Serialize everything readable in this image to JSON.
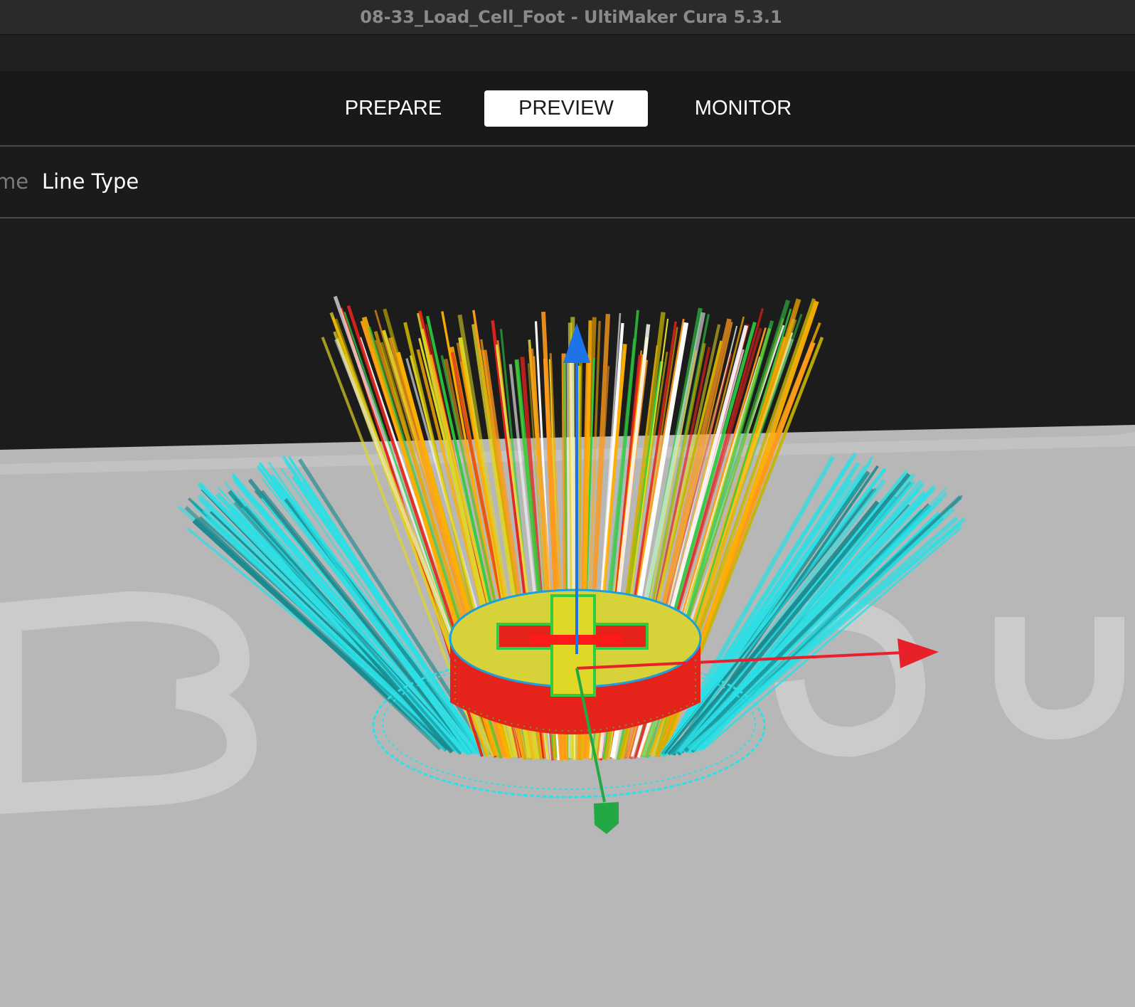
{
  "window": {
    "title": "08-33_Load_Cell_Foot - UltiMaker Cura 5.3.1"
  },
  "stages": [
    {
      "label": "PREPARE",
      "active": false
    },
    {
      "label": "PREVIEW",
      "active": true
    },
    {
      "label": "MONITOR",
      "active": false
    }
  ],
  "view_toolbar": {
    "prefix_partial": "me",
    "line_type_label": "Line Type"
  },
  "scene": {
    "colors": {
      "background": "#1c1c1c",
      "build_plate": "#b5b5b5",
      "skirt_brim": "#2be0e6",
      "infill": "#e0d826",
      "wall_outer": "#e5231b",
      "wall_inner": "#2ecc40",
      "travel": "#ff9a1a",
      "axis_x": "#e8202a",
      "axis_y": "#22a845",
      "axis_z": "#1e73e8"
    },
    "icons": {
      "axis_x": "arrow-right-icon",
      "axis_y": "arrow-down-icon",
      "axis_z": "arrow-up-icon"
    }
  }
}
